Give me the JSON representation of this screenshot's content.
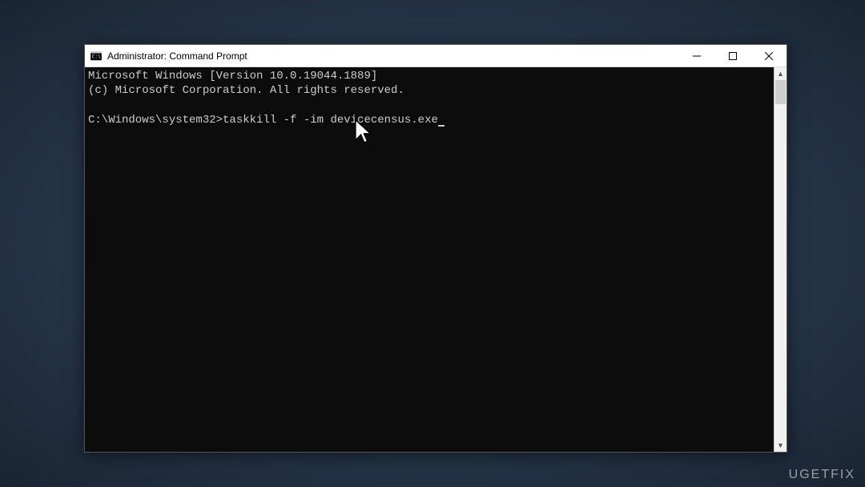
{
  "titlebar": {
    "title": "Administrator: Command Prompt"
  },
  "console": {
    "line1": "Microsoft Windows [Version 10.0.19044.1889]",
    "line2": "(c) Microsoft Corporation. All rights reserved.",
    "blank": "",
    "prompt": "C:\\Windows\\system32>",
    "command": "taskkill -f -im devicecensus.exe"
  },
  "watermark": "UGETFIX"
}
